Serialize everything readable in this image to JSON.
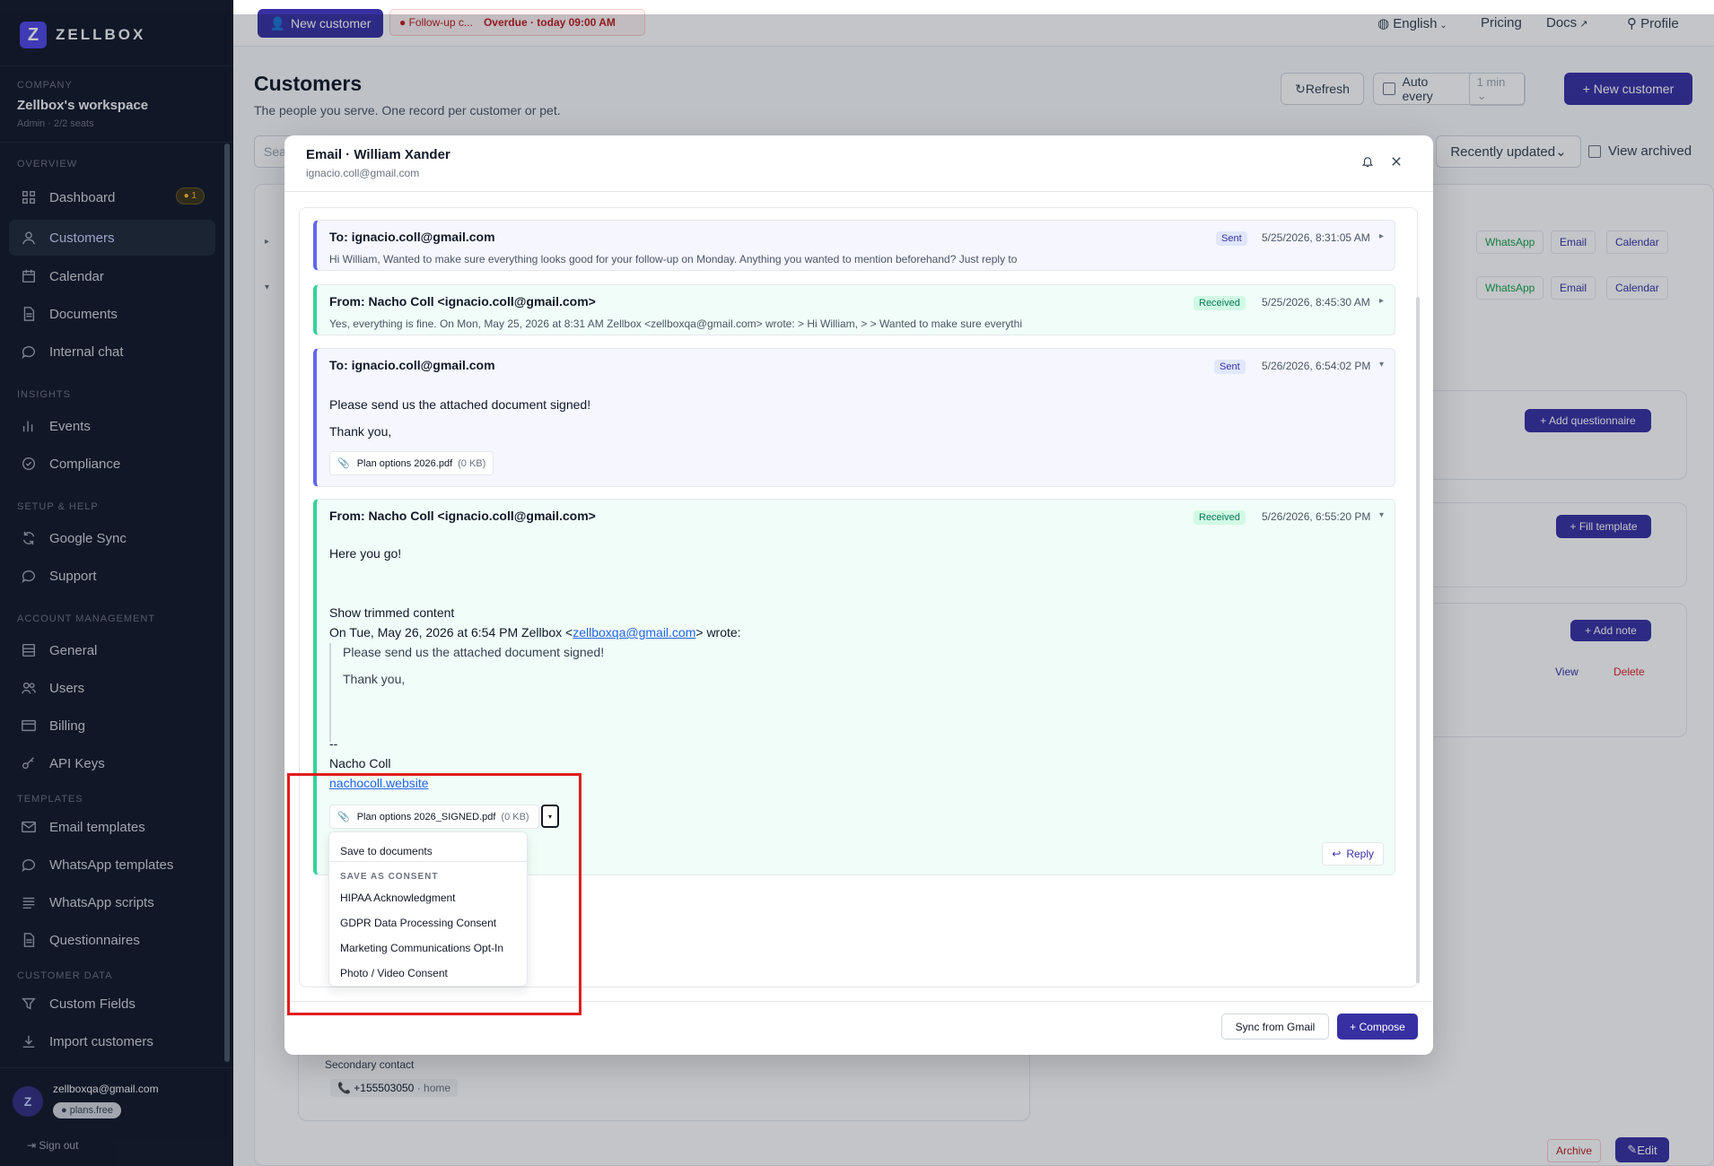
{
  "brand": {
    "logo_letter": "Z",
    "name": "ZELLBOX"
  },
  "company": {
    "section": "COMPANY",
    "name": "Zellbox's workspace",
    "sub": "Admin · 2/2 seats"
  },
  "sections": {
    "overview": "OVERVIEW",
    "insights": "INSIGHTS",
    "setup": "SETUP & HELP",
    "account": "ACCOUNT MANAGEMENT",
    "templates": "TEMPLATES",
    "customer_data": "CUSTOMER DATA"
  },
  "nav": {
    "dashboard": "Dashboard",
    "dashboard_badge": "● 1",
    "customers": "Customers",
    "calendar": "Calendar",
    "documents": "Documents",
    "internal_chat": "Internal chat",
    "events": "Events",
    "compliance": "Compliance",
    "google_sync": "Google Sync",
    "support": "Support",
    "general": "General",
    "users": "Users",
    "billing": "Billing",
    "api_keys": "API Keys",
    "email_templates": "Email templates",
    "whatsapp_templates": "WhatsApp templates",
    "whatsapp_scripts": "WhatsApp scripts",
    "questionnaires": "Questionnaires",
    "custom_fields": "Custom Fields",
    "import_customers": "Import customers"
  },
  "account": {
    "initial": "Z",
    "email": "zellboxqa@gmail.com",
    "plan": "● plans.free",
    "signout": "Sign out"
  },
  "topbar": {
    "new_customer": "New customer",
    "followup": "● Follow-up c...",
    "overdue": "Overdue · today 09:00 AM",
    "language": "English",
    "pricing": "Pricing",
    "docs": "Docs",
    "profile": "Profile"
  },
  "page": {
    "title": "Customers",
    "subtitle": "The people you serve. One record per customer or pet.",
    "refresh": "Refresh",
    "auto_every": "Auto every",
    "interval": "1 min",
    "new_customer": "+ New customer",
    "search_placeholder": "Sea",
    "sort": "Recently updated",
    "view_archived": "View archived"
  },
  "bg": {
    "whatsapp": "WhatsApp",
    "email": "Email",
    "calendar": "Calendar",
    "add_questionnaire": "+ Add questionnaire",
    "fill_template": "+ Fill template",
    "add_note": "+ Add note",
    "view": "View",
    "delete": "Delete",
    "secondary_contact": "Secondary contact",
    "phone": "+155503050",
    "phone_tag": "· home",
    "archive": "Archive",
    "edit": "Edit"
  },
  "modal": {
    "title": "Email · William Xander",
    "subtitle": "ignacio.coll@gmail.com",
    "messages": [
      {
        "header": "To: ignacio.coll@gmail.com",
        "status": "Sent",
        "date": "5/25/2026, 8:31:05 AM",
        "preview": "Hi William, Wanted to make sure everything looks good for your follow-up on Monday. Anything you wanted to mention beforehand? Just reply to"
      },
      {
        "header": "From: Nacho Coll <ignacio.coll@gmail.com>",
        "status": "Received",
        "date": "5/25/2026, 8:45:30 AM",
        "preview": "Yes, everything is fine. On Mon, May 25, 2026 at 8:31 AM Zellbox <zellboxqa@gmail.com> wrote: > Hi William, > > Wanted to make sure everythi"
      },
      {
        "header": "To: ignacio.coll@gmail.com",
        "status": "Sent",
        "date": "5/26/2026, 6:54:02 PM",
        "line1": "Please send us the attached document signed!",
        "line2": "Thank you,",
        "attachment": "Plan options 2026.pdf",
        "size": "(0 KB)"
      },
      {
        "header": "From: Nacho Coll <ignacio.coll@gmail.com>",
        "status": "Received",
        "date": "5/26/2026, 6:55:20 PM",
        "line1": "Here you go!",
        "trimmed": "Show trimmed content",
        "on_line_a": "On Tue, May 26, 2026 at 6:54 PM Zellbox <",
        "on_link": "zellboxqa@gmail.com",
        "on_line_b": "> wrote:",
        "q1": "Please send us the attached document signed!",
        "q2": "Thank you,",
        "dashes": "--",
        "sig_name": "Nacho Coll",
        "sig_link": "nachocoll.website",
        "attachment": "Plan options 2026_SIGNED.pdf",
        "size": "(0 KB)",
        "reply": "Reply"
      }
    ],
    "menu": {
      "save_docs": "Save to documents",
      "section": "SAVE AS CONSENT",
      "items": [
        "HIPAA Acknowledgment",
        "GDPR Data Processing Consent",
        "Marketing Communications Opt-In",
        "Photo / Video Consent"
      ]
    },
    "sync": "Sync from Gmail",
    "compose": "+ Compose"
  },
  "colors": {
    "accent": "#3730a3",
    "sent_border": "#6366f1",
    "received_border": "#34d399",
    "highlight": "#e11d1d"
  }
}
